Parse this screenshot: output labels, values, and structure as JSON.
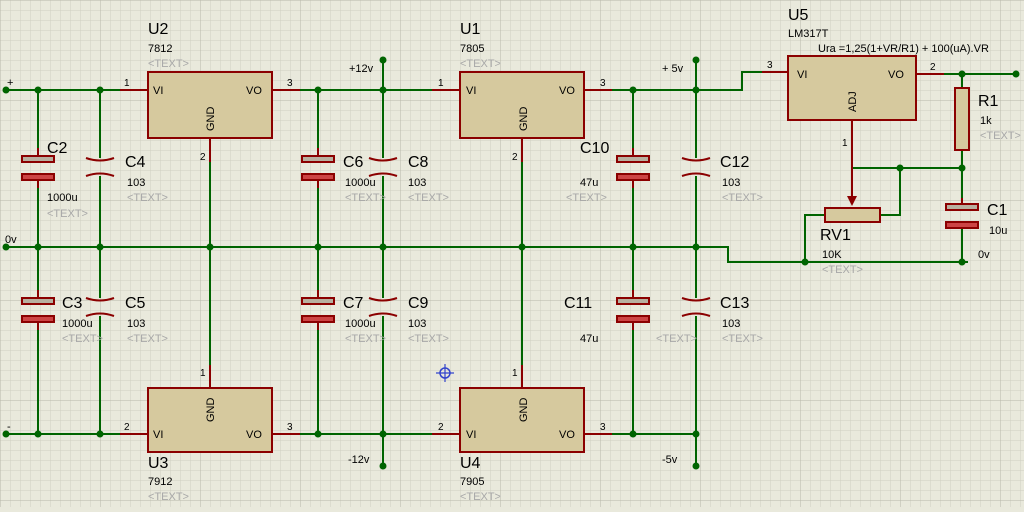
{
  "schematic": {
    "regulators": {
      "u2": {
        "ref": "U2",
        "value": "7812",
        "text": "<TEXT>"
      },
      "u1": {
        "ref": "U1",
        "value": "7805",
        "text": "<TEXT>"
      },
      "u3": {
        "ref": "U3",
        "value": "7912",
        "text": "<TEXT>"
      },
      "u4": {
        "ref": "U4",
        "value": "7905",
        "text": "<TEXT>"
      },
      "u5": {
        "ref": "U5",
        "value": "LM317T",
        "formula": "Ura =1,25(1+VR/R1) + 100(uA).VR"
      }
    },
    "pin_labels": {
      "vi": "VI",
      "vo": "VO",
      "gnd": "GND",
      "adj": "ADJ"
    },
    "pin_numbers": {
      "one": "1",
      "two": "2",
      "three": "3"
    },
    "capacitors": {
      "c2": {
        "ref": "C2",
        "value": "1000u",
        "text": "<TEXT>"
      },
      "c4": {
        "ref": "C4",
        "value": "103",
        "text": "<TEXT>"
      },
      "c3": {
        "ref": "C3",
        "value": "1000u",
        "text": "<TEXT>"
      },
      "c5": {
        "ref": "C5",
        "value": "103",
        "text": "<TEXT>"
      },
      "c6": {
        "ref": "C6",
        "value": "1000u",
        "text": "<TEXT>"
      },
      "c8": {
        "ref": "C8",
        "value": "103",
        "text": "<TEXT>"
      },
      "c7": {
        "ref": "C7",
        "value": "1000u",
        "text": "<TEXT>"
      },
      "c9": {
        "ref": "C9",
        "value": "103",
        "text": "<TEXT>"
      },
      "c10": {
        "ref": "C10",
        "value": "47u",
        "text": "<TEXT>"
      },
      "c12": {
        "ref": "C12",
        "value": "103",
        "text": "<TEXT>"
      },
      "c11": {
        "ref": "C11",
        "value": "47u"
      },
      "c13": {
        "ref": "C13",
        "value": "103",
        "text": "<TEXT>"
      },
      "c1": {
        "ref": "C1",
        "value": "10u"
      }
    },
    "resistors": {
      "r1": {
        "ref": "R1",
        "value": "1k",
        "text": "<TEXT>"
      },
      "rv1": {
        "ref": "RV1",
        "value": "10K",
        "text": "<TEXT>"
      }
    },
    "net_labels": {
      "plus": "+",
      "minus": "-",
      "zero_left": "0v",
      "zero_right": "0v",
      "p12": "+12v",
      "p5": "+ 5v",
      "n12": "-12v",
      "n5": "-5v"
    }
  }
}
